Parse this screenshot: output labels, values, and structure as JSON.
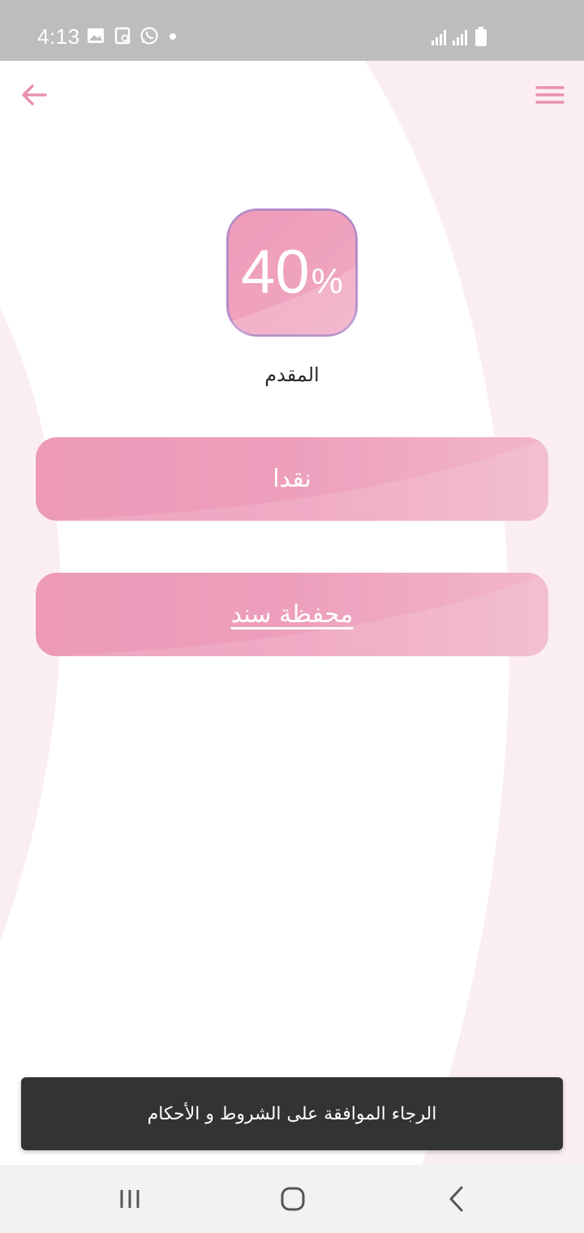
{
  "status_bar": {
    "time": "4:13",
    "icons": [
      "image-icon",
      "screenshot-icon",
      "whatsapp-icon",
      "dot-icon"
    ],
    "right_icons": [
      "signal-icon",
      "signal-icon",
      "battery-icon"
    ]
  },
  "header": {
    "back_icon": "arrow-left-icon",
    "menu_icon": "hamburger-menu-icon"
  },
  "progress": {
    "value_number": "40",
    "value_symbol": "%",
    "value_fraction": 0.4,
    "label": "المقدم"
  },
  "payment_options": [
    {
      "label": "نقدا"
    },
    {
      "label": "محفظة سند"
    }
  ],
  "toast": {
    "message": "الرجاء الموافقة على الشروط و الأحكام"
  },
  "navbar": {
    "icons": [
      "recent-apps-icon",
      "home-icon",
      "back-icon"
    ]
  },
  "colors": {
    "accent": "#e88fb0",
    "button": "#ec9ab8",
    "background_decor": "#fbeef3",
    "toast_bg": "#333333"
  }
}
